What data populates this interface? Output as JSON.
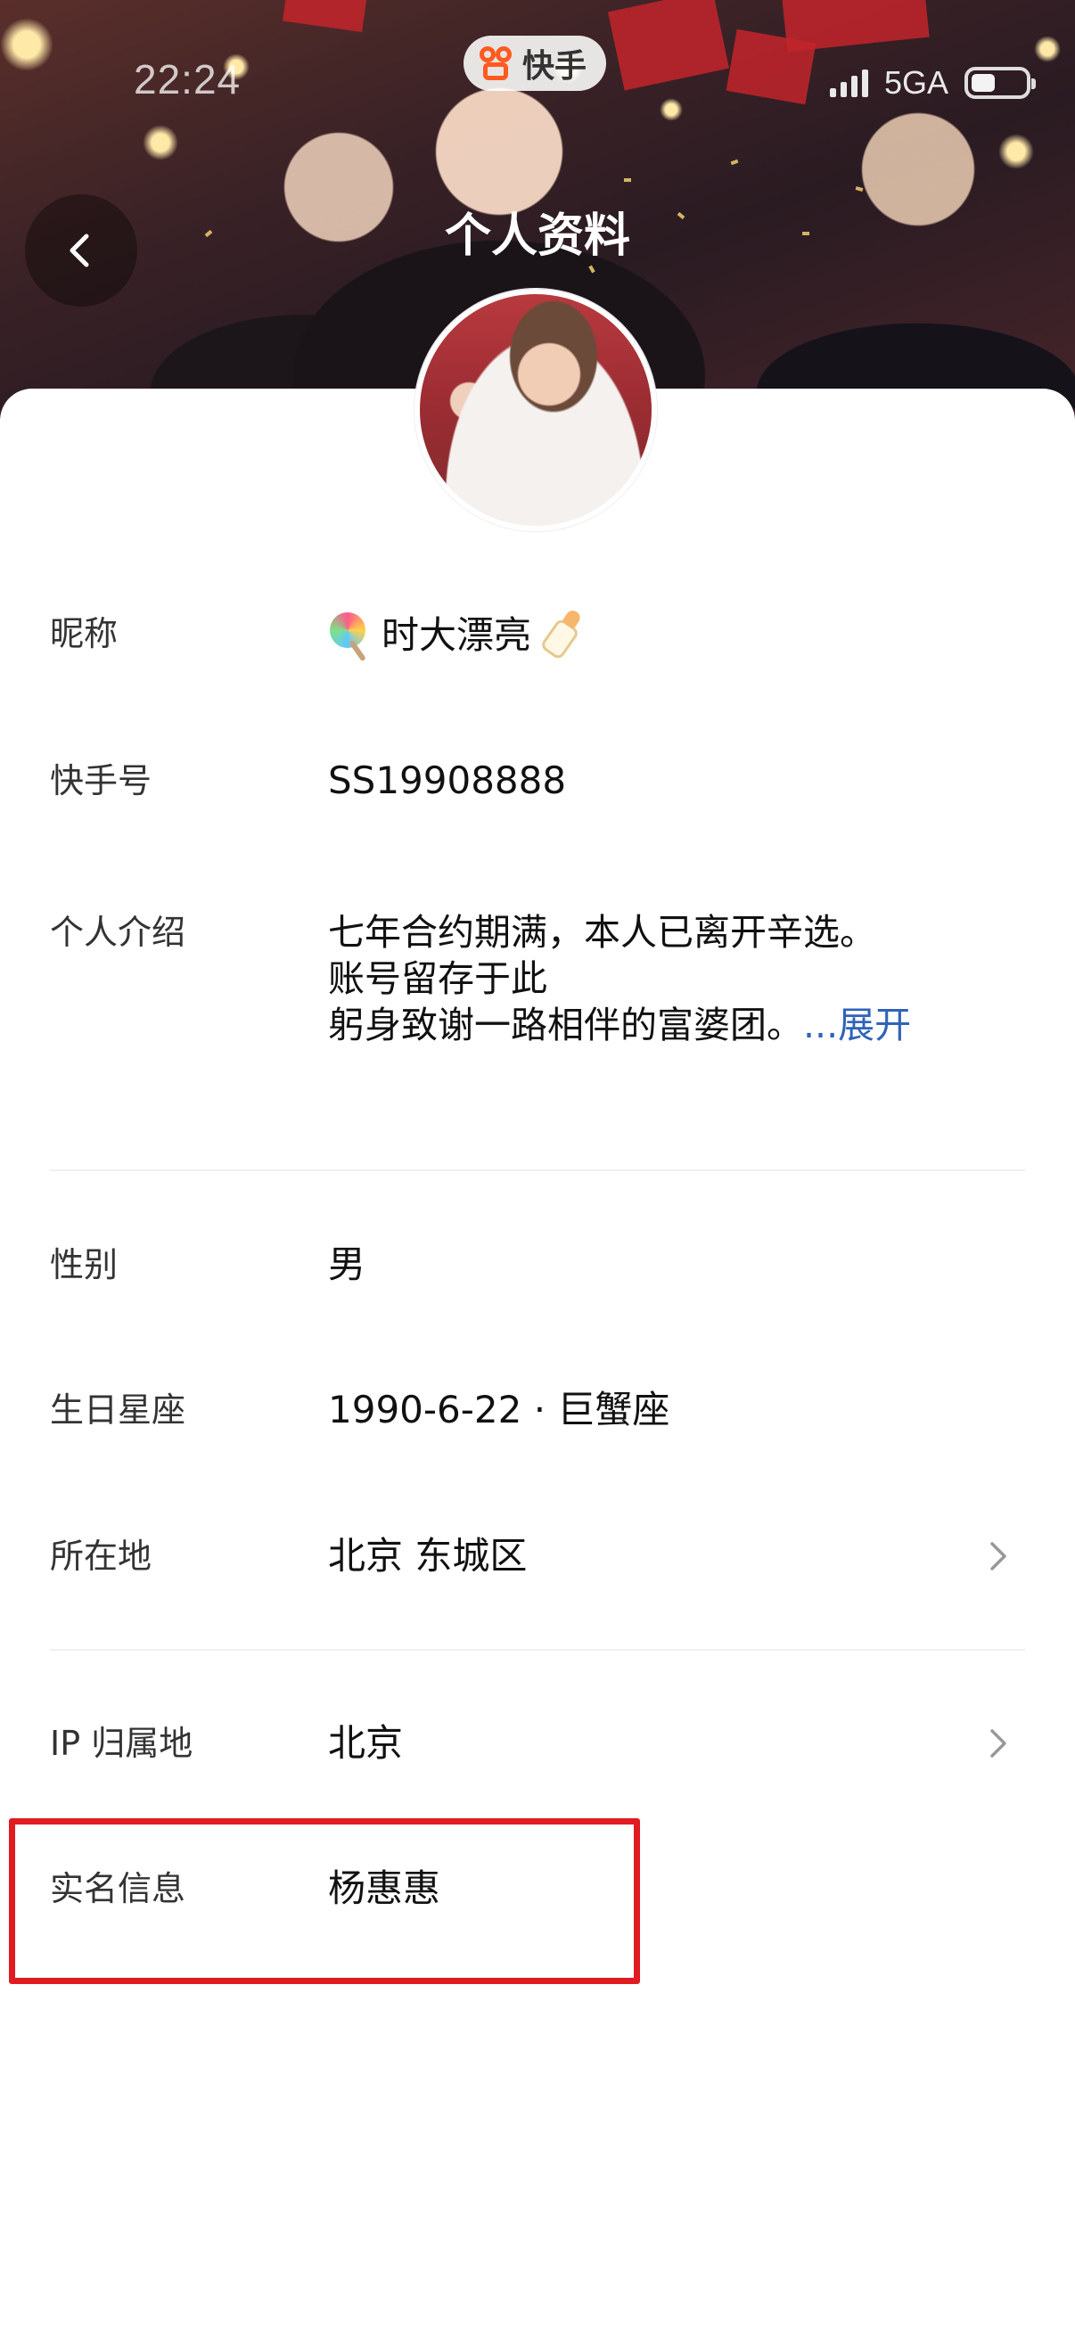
{
  "status_bar": {
    "time": "22:24",
    "network": "5GA"
  },
  "app_badge": {
    "label": "快手"
  },
  "header": {
    "title": "个人资料"
  },
  "profile": {
    "nickname_label": "昵称",
    "nickname_value": "时大漂亮",
    "id_label": "快手号",
    "id_value": "SS19908888",
    "intro_label": "个人介绍",
    "intro_lines": [
      "七年合约期满，本人已离开辛选。",
      "账号留存于此",
      "躬身致谢一路相伴的富婆团。"
    ],
    "intro_expand": "...展开",
    "gender_label": "性别",
    "gender_value": "男",
    "birthday_label": "生日星座",
    "birthday_value": "1990-6-22 · 巨蟹座",
    "location_label": "所在地",
    "location_value": "北京 东城区",
    "ip_label": "IP 归属地",
    "ip_value": "北京",
    "realname_label": "实名信息",
    "realname_value": "杨惠惠"
  },
  "colors": {
    "accent_link": "#2f63b8",
    "highlight": "#e01b22",
    "app_brand": "#ff5a1f"
  },
  "icons": {
    "back": "chevron-left-icon",
    "row_arrow": "chevron-right-icon",
    "emoji_left": "lollipop-emoji",
    "emoji_right": "baby-bottle-emoji"
  }
}
